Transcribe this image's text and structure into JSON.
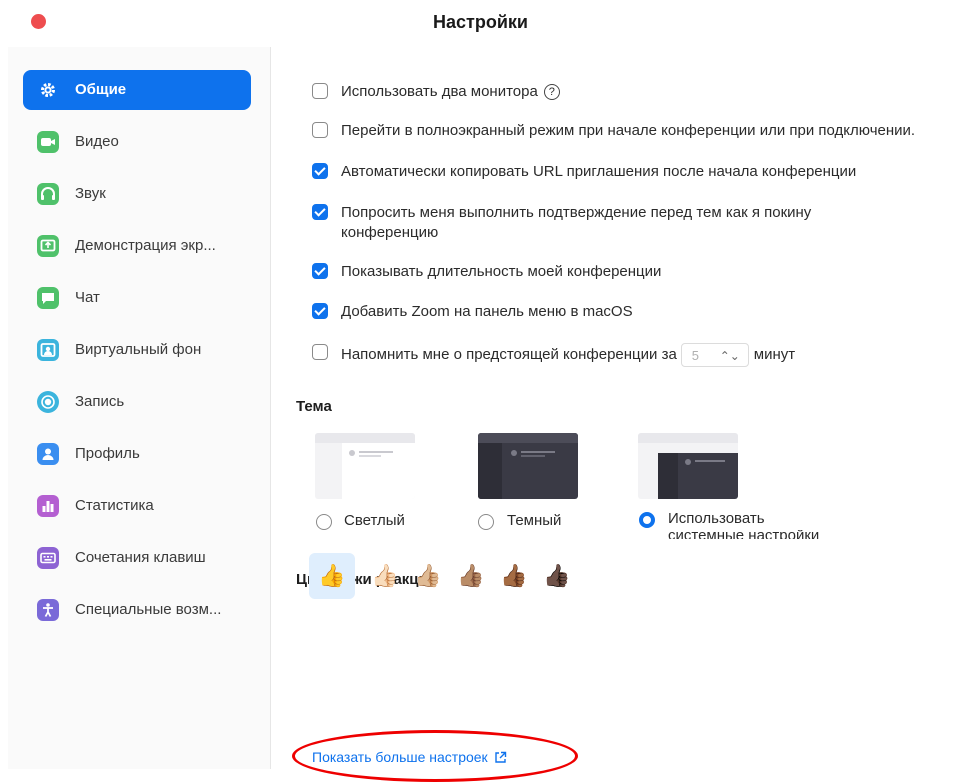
{
  "window": {
    "title": "Настройки"
  },
  "sidebar": {
    "items": [
      {
        "label": "Общие",
        "icon": "gear-icon",
        "color": "#ffffff",
        "active": true
      },
      {
        "label": "Видео",
        "icon": "video-camera-icon",
        "color": "#4fc16a"
      },
      {
        "label": "Звук",
        "icon": "headphones-icon",
        "color": "#4fc16a"
      },
      {
        "label": "Демонстрация экр...",
        "icon": "share-screen-icon",
        "color": "#4fc16a"
      },
      {
        "label": "Чат",
        "icon": "chat-icon",
        "color": "#4fc16a"
      },
      {
        "label": "Виртуальный фон",
        "icon": "virtual-background-icon",
        "color": "#3bb4dd"
      },
      {
        "label": "Запись",
        "icon": "record-icon",
        "color": "#3bb4dd"
      },
      {
        "label": "Профиль",
        "icon": "profile-icon",
        "color": "#3a8ef0"
      },
      {
        "label": "Статистика",
        "icon": "statistics-icon",
        "color": "#b45fd1"
      },
      {
        "label": "Сочетания клавиш",
        "icon": "keyboard-icon",
        "color": "#8d63d3"
      },
      {
        "label": "Специальные возм...",
        "icon": "accessibility-icon",
        "color": "#7a6ad8"
      }
    ]
  },
  "general": {
    "options": [
      {
        "label": "Использовать два монитора",
        "checked": false,
        "help": "?"
      },
      {
        "label": "Перейти в полноэкранный режим при начале конференции или при подключении.",
        "checked": false
      },
      {
        "label": "Автоматически копировать URL приглашения после начала конференции",
        "checked": true
      },
      {
        "label": "Попросить меня выполнить подтверждение перед тем как я покину",
        "label2": "конференцию",
        "checked": true
      },
      {
        "label": "Показывать длительность моей конференции",
        "checked": true
      },
      {
        "label": "Добавить Zoom на панель меню в macOS",
        "checked": true
      },
      {
        "label": "Напомнить мне о предстоящей конференции за",
        "checked": false,
        "stepper_value": "5",
        "suffix": "минут"
      }
    ],
    "theme_title": "Тема",
    "themes": [
      {
        "label": "Светлый",
        "selected": false
      },
      {
        "label": "Темный",
        "selected": false
      },
      {
        "label": "Использовать",
        "label2": "системные настройки",
        "selected": true
      }
    ],
    "skin_title": "Цвет кожи реакции",
    "skin_tones": [
      "👍",
      "👍🏻",
      "👍🏼",
      "👍🏽",
      "👍🏾",
      "👍🏿"
    ],
    "more_link": "Показать больше настроек"
  },
  "colors": {
    "accent": "#0e72ed",
    "close": "#ee4d4f",
    "highlight": "#e00000"
  }
}
